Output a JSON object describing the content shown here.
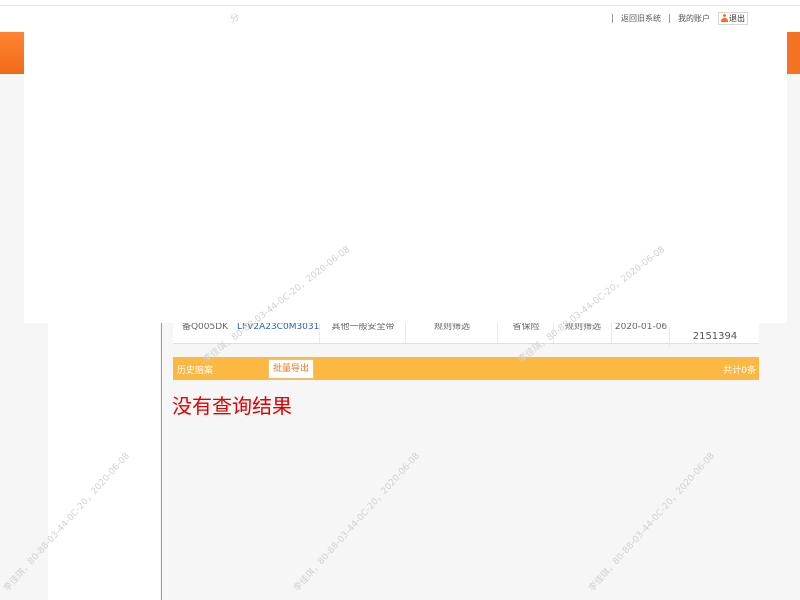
{
  "header": {
    "watermark_top": "分",
    "links": [
      "返回旧系统",
      "我的账户"
    ],
    "logout_label": "退出"
  },
  "table": {
    "row": {
      "col1": "备Q005DK",
      "col2": "LFV2A23C0M3031033",
      "col3": "其他一般安全带",
      "col4": "规则筛选",
      "col5": "省保险",
      "col6": "规则筛选",
      "col7": "2020-01-06",
      "col8": "2151394"
    }
  },
  "history": {
    "title": "历史赔案",
    "export_label": "批量导出",
    "total": "共计0条"
  },
  "result": {
    "message": "没有查询结果"
  },
  "watermarks": [
    "李佳琪，80-88-03-44-0C-20，2020-06-08",
    "李佳琪，80-88-03-44-0C-20，2020-06-08",
    "李佳琪，80-88-03-44-0C-20，2020-06-08",
    "李佳琪，80-88-03-44-0C-20，2020-06-08",
    "李佳琪，80-88-03-44-0C-20，2020-06-08"
  ],
  "colors": {
    "accent_orange": "#f27422",
    "history_bar": "#fbb944",
    "error_red": "#e00000",
    "link_blue": "#2a63b8"
  }
}
